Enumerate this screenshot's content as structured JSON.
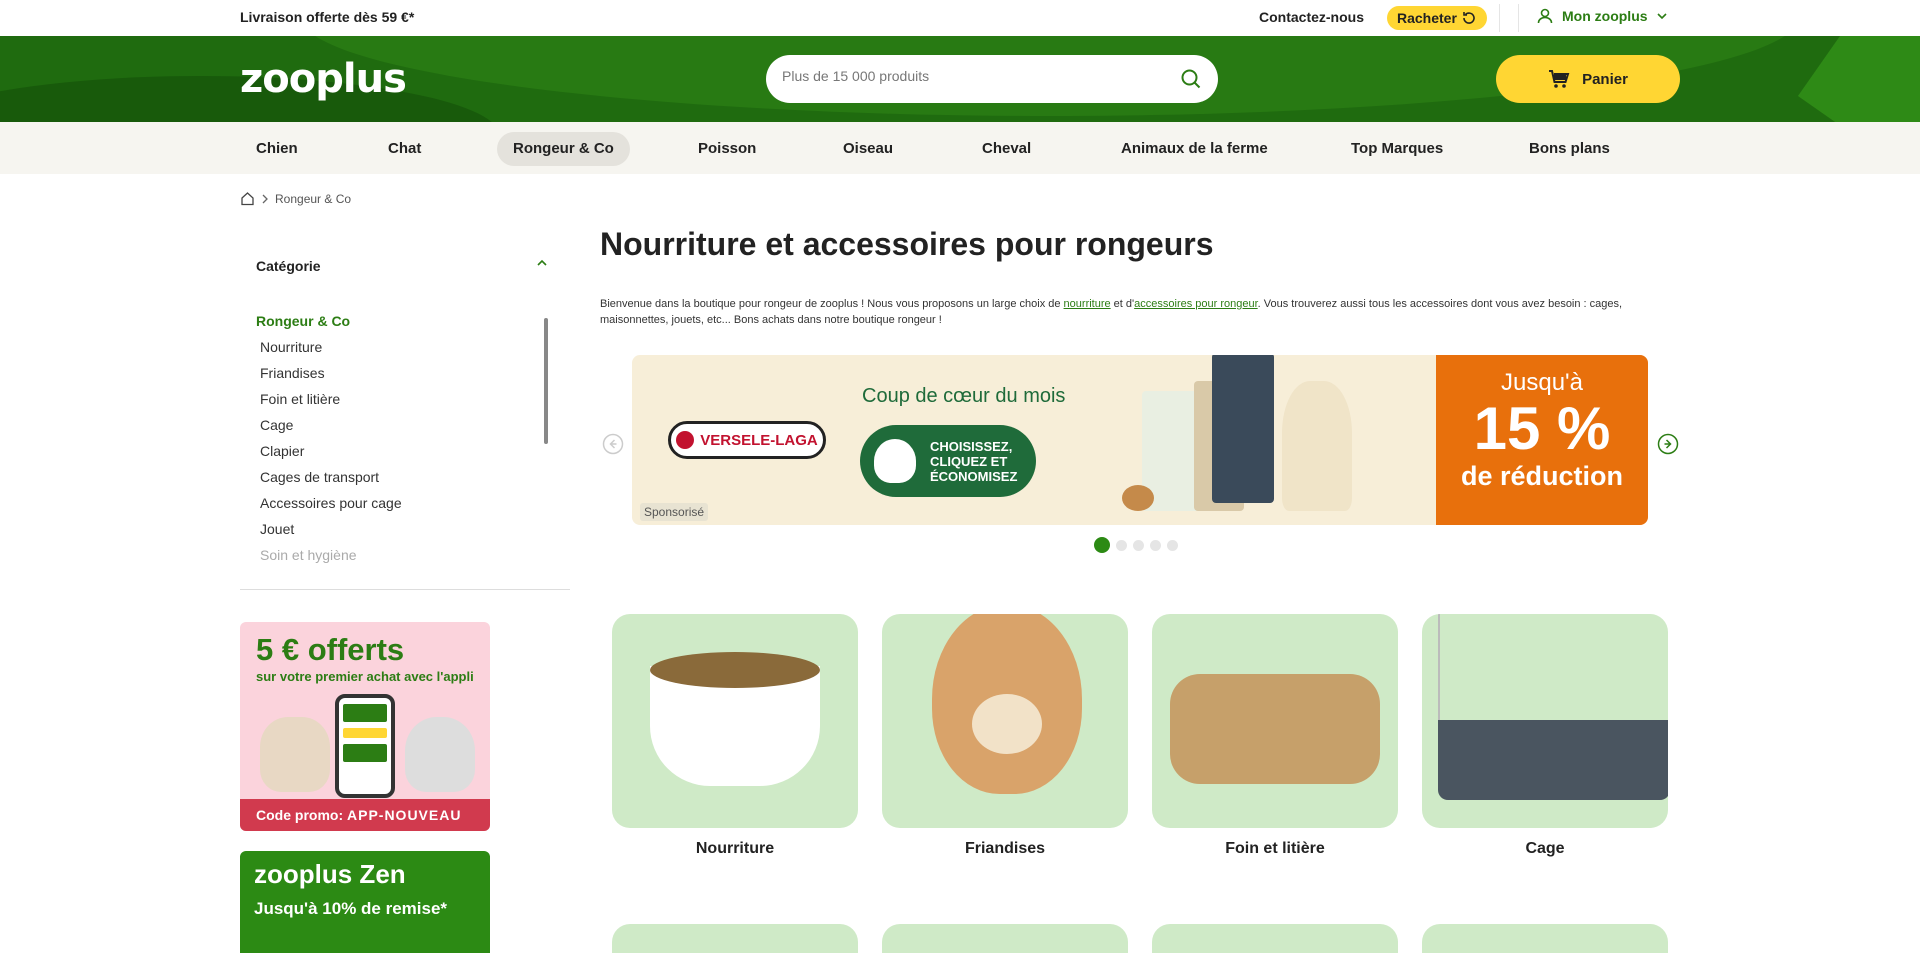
{
  "topbar": {
    "shipping": "Livraison offerte dès 59 €*",
    "contact": "Contactez-nous",
    "reorder": "Racheter",
    "account": "Mon zooplus"
  },
  "header": {
    "logo": "zooplus",
    "search_placeholder": "Plus de 15 000 produits",
    "cart": "Panier"
  },
  "nav": [
    {
      "label": "Chien"
    },
    {
      "label": "Chat"
    },
    {
      "label": "Rongeur & Co",
      "active": true
    },
    {
      "label": "Poisson"
    },
    {
      "label": "Oiseau"
    },
    {
      "label": "Cheval"
    },
    {
      "label": "Animaux de la ferme"
    },
    {
      "label": "Top Marques"
    },
    {
      "label": "Bons plans"
    }
  ],
  "breadcrumb": {
    "current": "Rongeur & Co"
  },
  "sidebar": {
    "category_title": "Catégorie",
    "root": "Rongeur & Co",
    "items": [
      "Nourriture",
      "Friandises",
      "Foin et litière",
      "Cage",
      "Clapier",
      "Cages de transport",
      "Accessoires pour cage",
      "Jouet",
      "Soin et hygiène"
    ],
    "promo1": {
      "title": "5 € offerts",
      "subtitle": "sur votre premier achat avec l'appli",
      "code_label": "Code promo:",
      "code": "APP-NOUVEAU"
    },
    "promo2": {
      "title": "zooplus Zen",
      "subtitle": "Jusqu'à 10% de remise*"
    }
  },
  "main": {
    "title": "Nourriture et accessoires pour rongeurs",
    "intro_1": "Bienvenue dans la boutique pour rongeur de zooplus ! Nous vous proposons un large choix de ",
    "intro_link1": "nourriture",
    "intro_2": " et d'",
    "intro_link2": "accessoires pour rongeur",
    "intro_3": ". Vous trouverez aussi tous les accessoires dont vous avez besoin : cages, maisonnettes, jouets, etc... Bons achats dans notre boutique rongeur !"
  },
  "banner": {
    "brand": "VERSELE-LAGA",
    "headline": "Coup de cœur du mois",
    "pill": "CHOISISSEZ, CLIQUEZ ET ÉCONOMISEZ",
    "promo_top": "Jusqu'à",
    "promo_value": "15 %",
    "promo_bottom": "de réduction",
    "sponsor": "Sponsorisé",
    "dots": 5,
    "active_dot": 1
  },
  "tiles": [
    {
      "label": "Nourriture"
    },
    {
      "label": "Friandises"
    },
    {
      "label": "Foin et litière"
    },
    {
      "label": "Cage"
    }
  ],
  "colors": {
    "brand_green": "#2c7d14",
    "header_green": "#1f6b0f",
    "accent_yellow": "#ffd633",
    "tile_green": "#cfeac7",
    "promo_orange": "#e8700c"
  }
}
